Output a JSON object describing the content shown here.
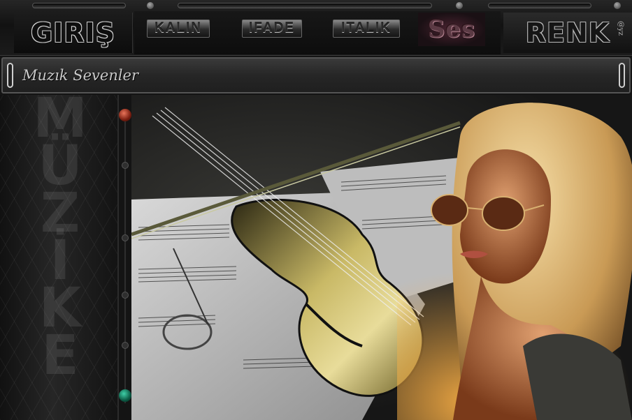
{
  "toolbar": {
    "giris": "GIRIŞ",
    "kalin": "KALIN",
    "ifade": "IFADE",
    "italik": "ITALIK",
    "ses": "Ses",
    "renk": "RENK",
    "renk_note": "@yz"
  },
  "title_bar": {
    "title": "Muzık Sevenler"
  },
  "side_panel": {
    "word": "MÜZİK"
  },
  "colors": {
    "knob_top": "#c0391f",
    "knob_bottom": "#1a9a78",
    "ses_accent": "#5b3a44"
  },
  "main_image": {
    "description": "violin-and-sheet-music-with-woman-in-sunglasses"
  }
}
